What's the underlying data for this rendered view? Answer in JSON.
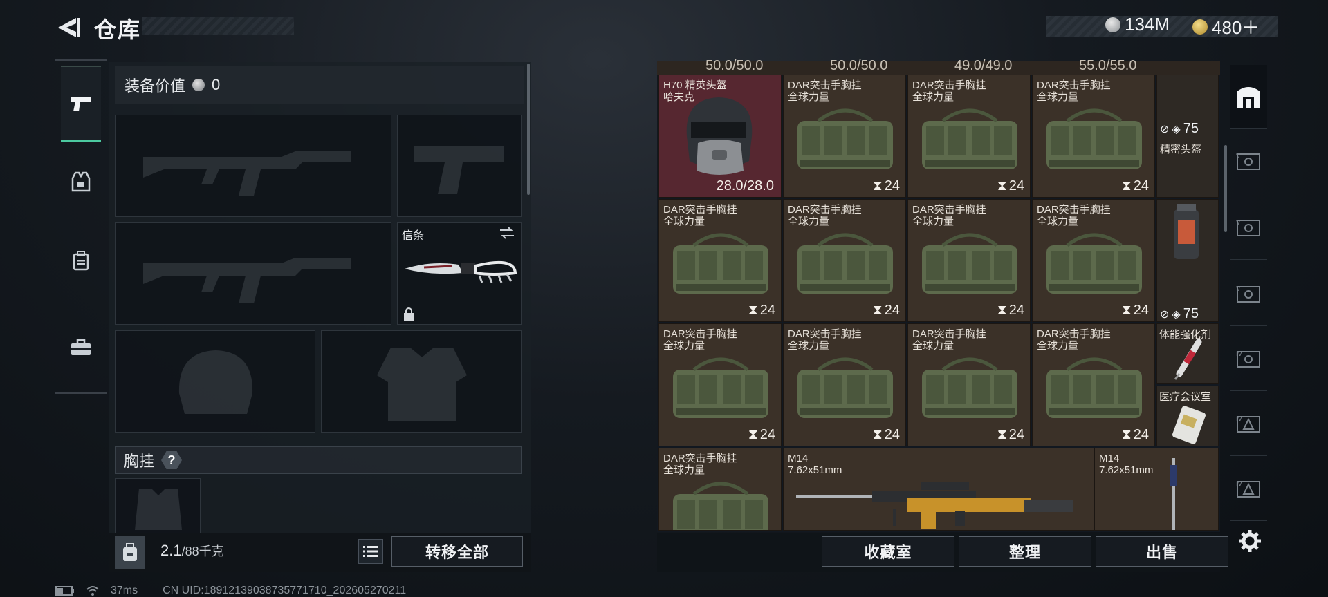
{
  "header": {
    "title": "仓库"
  },
  "currency": {
    "coins": "134M",
    "tokens": "480＋"
  },
  "equipment": {
    "value_label": "装备价值",
    "value_amount": "0",
    "melee_label": "信条",
    "vest_label": "胸挂",
    "help_mark": "?"
  },
  "backpack": {
    "weight": "2.1",
    "capacity": "/88千克",
    "transfer_all": "转移全部"
  },
  "inventory": {
    "top_values": [
      "50.0/50.0",
      "50.0/50.0",
      "49.0/49.0",
      "55.0/55.0"
    ],
    "helmet": {
      "name": "H70 精英头盔",
      "subtitle": "哈夫克",
      "durability": "28.0/28.0"
    },
    "rig_name": "DAR突击手胸挂",
    "rig_brand": "全球力量",
    "rig_count": "24",
    "side_armor": "75",
    "side_label_helmet": "精密头盔",
    "side_label_injector": "体能强化剂",
    "side_label_card": "医疗会议室",
    "m14": {
      "name": "M14",
      "caliber": "7.62x51mm"
    }
  },
  "actions": {
    "collection": "收藏室",
    "organize": "整理",
    "sell": "出售"
  },
  "status": {
    "ping": "37ms",
    "uid": "CN UID:18912139038735771710_202605270211"
  },
  "colors": {
    "accent_green": "#4cc9a0",
    "item_bg": "#3b3128",
    "helmet_bg": "#562730"
  }
}
